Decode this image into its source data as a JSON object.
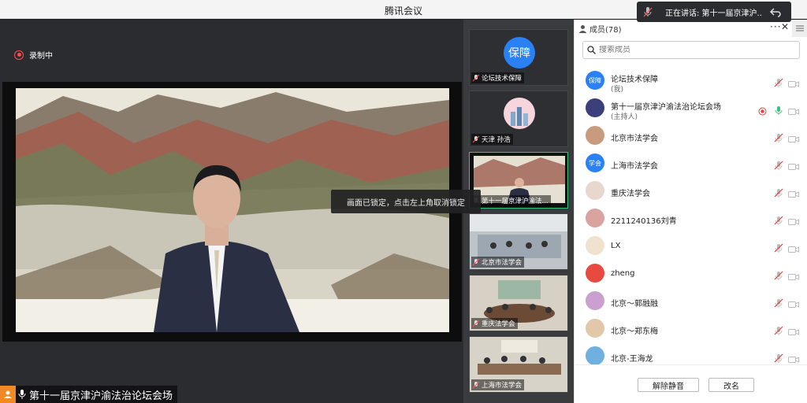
{
  "window": {
    "title": "腾讯会议"
  },
  "speaking_banner": {
    "text": "正在讲话: 第十一届京津沪..."
  },
  "recording": {
    "label": "录制中"
  },
  "main_video": {
    "name_label": "第十一届京津沪渝法治论坛会场",
    "lock_tip": "画面已锁定，点击左上角取消锁定"
  },
  "thumbnails": [
    {
      "label": "论坛技术保障",
      "avatar_text": "保障"
    },
    {
      "label": "天津 孙浩"
    },
    {
      "label": "第十一届京津沪渝法..."
    },
    {
      "label": "北京市法学会"
    },
    {
      "label": "重庆法学会"
    },
    {
      "label": "上海市法学会"
    }
  ],
  "panel": {
    "members_label": "成员(78)",
    "more_label": "···",
    "close_label": "✕",
    "search_placeholder": "搜索成员",
    "members": [
      {
        "name": "论坛技术保障",
        "sub": "(我)",
        "avatar_text": "保障",
        "avatar_color": "#2a80f5"
      },
      {
        "name": "第十一届京津沪渝法治论坛会场",
        "sub": "(主持人)",
        "avatar_text": "",
        "avatar_color": "#3b3f7a"
      },
      {
        "name": "北京市法学会",
        "sub": "",
        "avatar_text": "",
        "avatar_color": "#c89a7e"
      },
      {
        "name": "上海市法学会",
        "sub": "",
        "avatar_text": "学会",
        "avatar_color": "#2a80f5"
      },
      {
        "name": "重庆法学会",
        "sub": "",
        "avatar_text": "",
        "avatar_color": "#e8d7cc"
      },
      {
        "name": "2211240136刘青",
        "sub": "",
        "avatar_text": "",
        "avatar_color": "#d9a3a0"
      },
      {
        "name": "LX",
        "sub": "",
        "avatar_text": "",
        "avatar_color": "#f1e2d0"
      },
      {
        "name": "zheng",
        "sub": "",
        "avatar_text": "",
        "avatar_color": "#e94a3f"
      },
      {
        "name": "北京～郭融融",
        "sub": "",
        "avatar_text": "",
        "avatar_color": "#c9a0d0"
      },
      {
        "name": "北京～郑东梅",
        "sub": "",
        "avatar_text": "",
        "avatar_color": "#e0c8a8"
      },
      {
        "name": "北京-王海龙",
        "sub": "",
        "avatar_text": "",
        "avatar_color": "#6fb0e0"
      }
    ],
    "unmute_label": "解除静音",
    "rename_label": "改名"
  }
}
